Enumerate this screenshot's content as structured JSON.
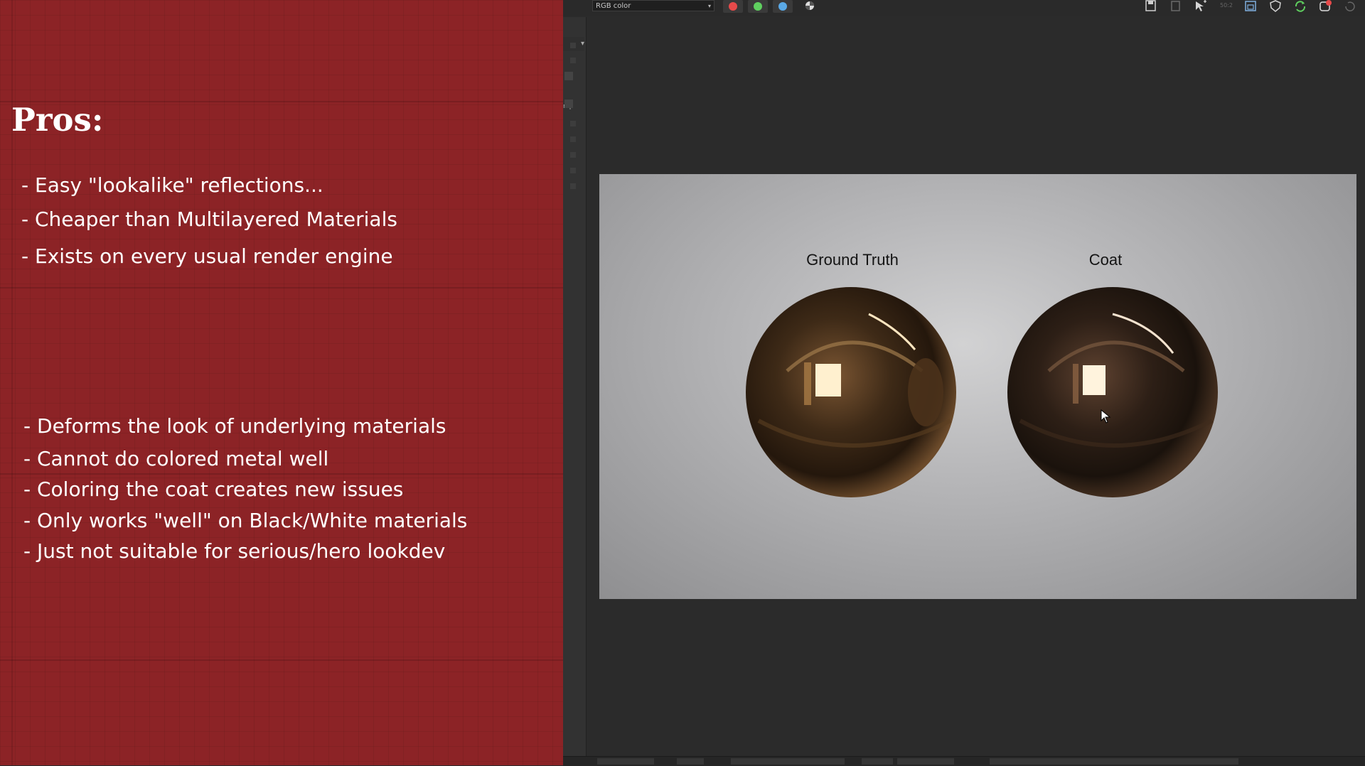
{
  "slide": {
    "title": "Pros:",
    "pros": [
      "- Easy \"lookalike\" reflections...",
      "- Cheaper than Multilayered Materials",
      "- Exists on every usual render engine"
    ],
    "cons": [
      "- Deforms the look of underlying materials",
      "- Cannot do colored metal well",
      "- Coloring the coat creates new issues",
      "- Only works \"well\" on Black/White materials",
      "- Just not suitable for serious/hero lookdev"
    ]
  },
  "app": {
    "channel_select": "RGB color",
    "strip_label": "mp",
    "channel_buttons": [
      {
        "name": "red-channel",
        "color": "#e64a4a"
      },
      {
        "name": "green-channel",
        "color": "#5fcf5f"
      },
      {
        "name": "blue-channel",
        "color": "#5aa9e6"
      }
    ],
    "toolbar_icons": [
      "save-icon",
      "copy-icon",
      "region-render-icon",
      "zoom-icon",
      "frame-icon",
      "shield-icon",
      "refresh-icon",
      "stop-render-icon",
      "history-icon"
    ],
    "viewer": {
      "labels": [
        "Ground Truth",
        "Coat"
      ]
    }
  }
}
